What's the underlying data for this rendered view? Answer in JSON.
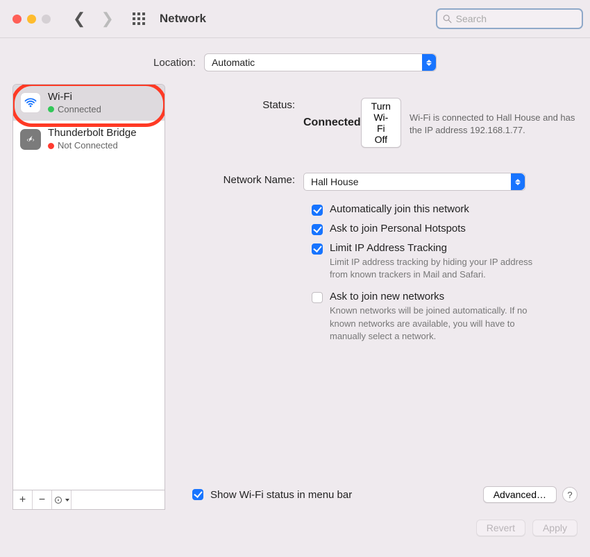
{
  "window": {
    "title": "Network"
  },
  "search": {
    "placeholder": "Search"
  },
  "location": {
    "label": "Location:",
    "value": "Automatic"
  },
  "sidebar": {
    "items": [
      {
        "name": "Wi-Fi",
        "status": "Connected",
        "connected": true
      },
      {
        "name": "Thunderbolt Bridge",
        "status": "Not Connected",
        "connected": false
      }
    ]
  },
  "detail": {
    "status_label": "Status:",
    "status_value": "Connected",
    "wifi_off_button": "Turn Wi-Fi Off",
    "status_desc": "Wi-Fi is connected to Hall House and has the IP address 192.168.1.77.",
    "network_name_label": "Network Name:",
    "network_name_value": "Hall House",
    "checks": {
      "auto_join": "Automatically join this network",
      "ask_hotspots": "Ask to join Personal Hotspots",
      "limit_ip": "Limit IP Address Tracking",
      "limit_ip_desc": "Limit IP address tracking by hiding your IP address from known trackers in Mail and Safari.",
      "ask_new": "Ask to join new networks",
      "ask_new_desc": "Known networks will be joined automatically. If no known networks are available, you will have to manually select a network."
    },
    "show_menubar": "Show Wi-Fi status in menu bar",
    "advanced_button": "Advanced…",
    "help_button": "?"
  },
  "footer": {
    "revert": "Revert",
    "apply": "Apply"
  }
}
